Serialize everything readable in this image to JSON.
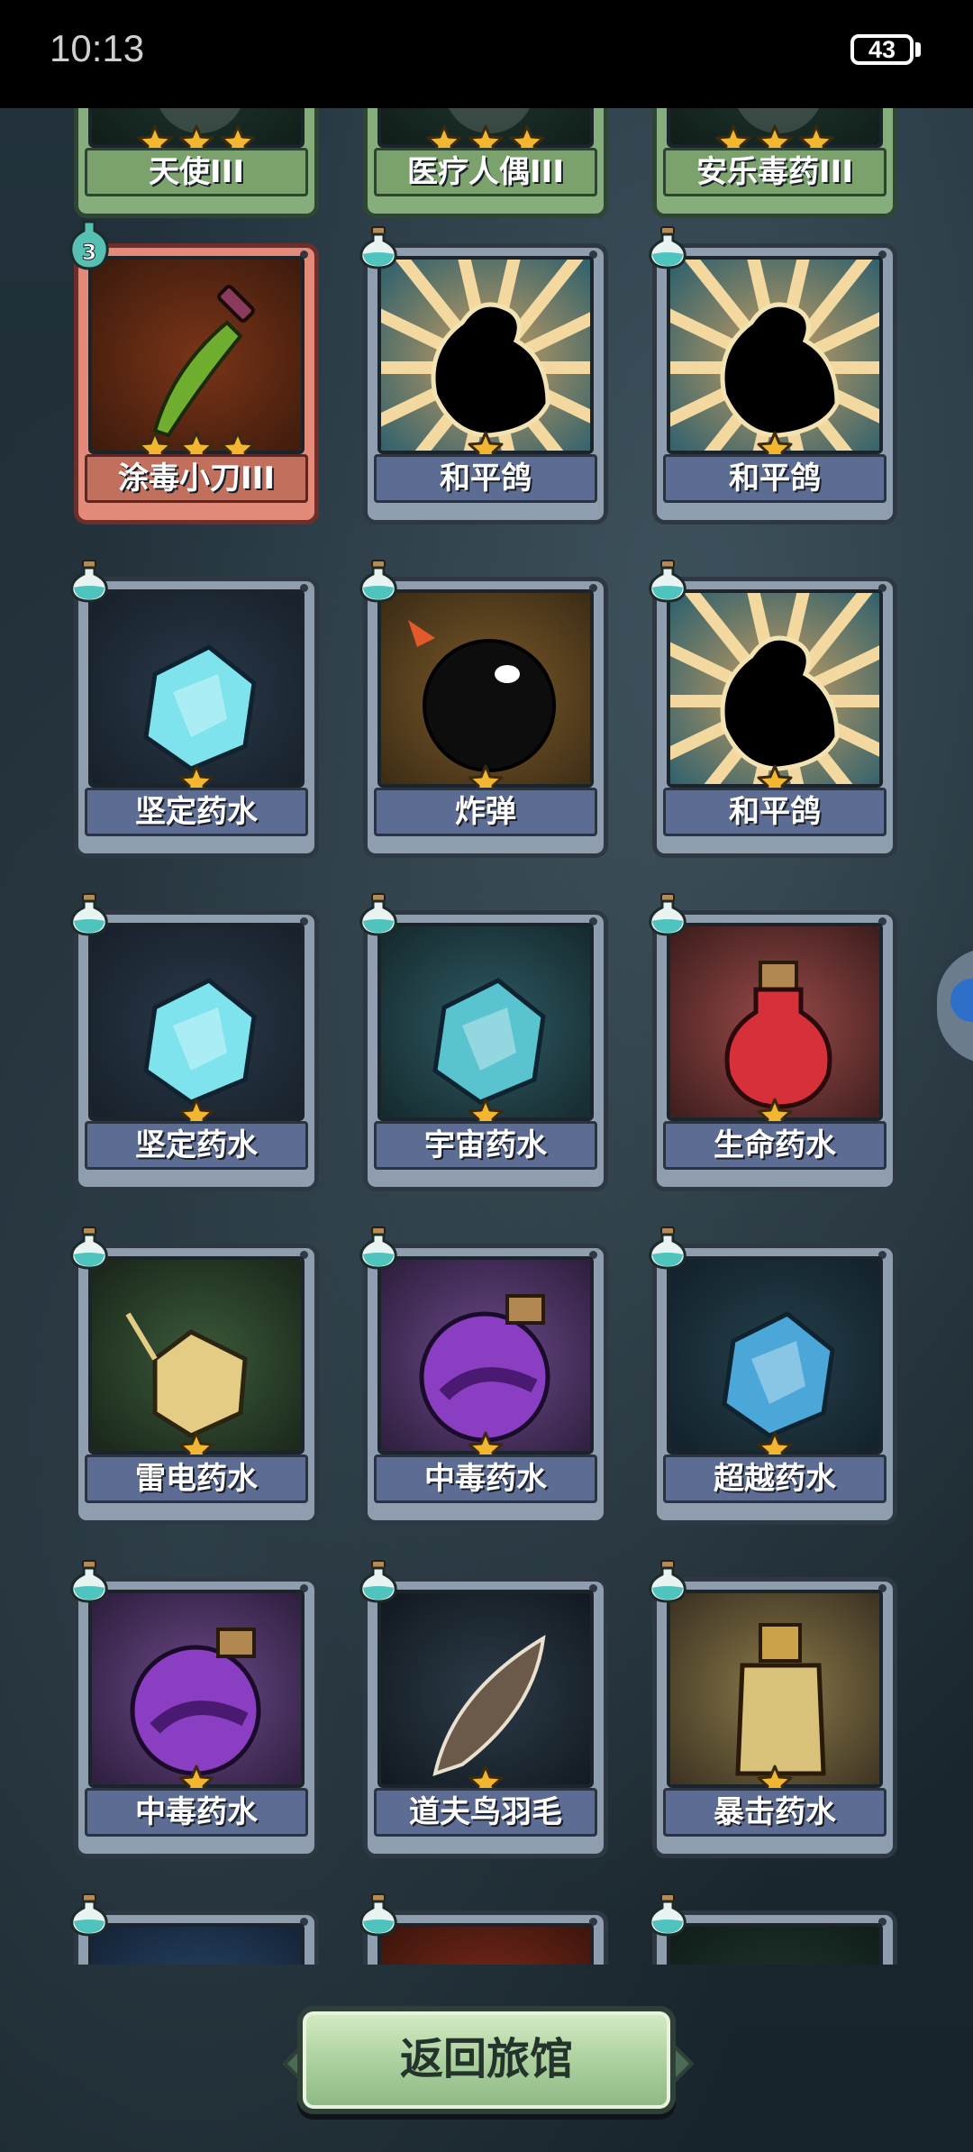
{
  "status_bar": {
    "time": "10:13",
    "battery": "43"
  },
  "cards": [
    {
      "name": "天使III",
      "stars": 3,
      "frame": "green",
      "partial_top": true
    },
    {
      "name": "医疗人偶III",
      "stars": 3,
      "frame": "green",
      "partial_top": true
    },
    {
      "name": "安乐毒药III",
      "stars": 3,
      "frame": "green",
      "partial_top": true
    },
    {
      "name": "涂毒小刀III",
      "stars": 3,
      "frame": "red",
      "level": "3",
      "art": "dagger"
    },
    {
      "name": "和平鸽",
      "stars": 1,
      "frame": "blue",
      "art": "dove"
    },
    {
      "name": "和平鸽",
      "stars": 1,
      "frame": "blue",
      "art": "dove"
    },
    {
      "name": "坚定药水",
      "stars": 1,
      "frame": "blue",
      "art": "crystal"
    },
    {
      "name": "炸弹",
      "stars": 1,
      "frame": "blue",
      "art": "bomb"
    },
    {
      "name": "和平鸽",
      "stars": 1,
      "frame": "blue",
      "art": "dove"
    },
    {
      "name": "坚定药水",
      "stars": 1,
      "frame": "blue",
      "art": "crystal"
    },
    {
      "name": "宇宙药水",
      "stars": 1,
      "frame": "blue",
      "art": "cosmic"
    },
    {
      "name": "生命药水",
      "stars": 1,
      "frame": "blue",
      "art": "life"
    },
    {
      "name": "雷电药水",
      "stars": 1,
      "frame": "blue",
      "art": "thunder"
    },
    {
      "name": "中毒药水",
      "stars": 1,
      "frame": "blue",
      "art": "poison"
    },
    {
      "name": "超越药水",
      "stars": 1,
      "frame": "blue",
      "art": "beyond"
    },
    {
      "name": "中毒药水",
      "stars": 1,
      "frame": "blue",
      "art": "poison"
    },
    {
      "name": "道夫鸟羽毛",
      "stars": 1,
      "frame": "blue",
      "art": "feather"
    },
    {
      "name": "暴击药水",
      "stars": 1,
      "frame": "blue",
      "art": "crit"
    },
    {
      "name": "",
      "stars": 0,
      "frame": "blue",
      "art": "partial-blue",
      "partial_bottom": true
    },
    {
      "name": "",
      "stars": 0,
      "frame": "blue",
      "art": "partial-red",
      "partial_bottom": true
    },
    {
      "name": "",
      "stars": 0,
      "frame": "blue",
      "art": "partial-dark",
      "partial_bottom": true
    }
  ],
  "buttons": {
    "return_label": "返回旅馆"
  },
  "colors": {
    "label_blue": "#5d6c92",
    "label_red": "#c0705c",
    "label_green": "#7ba16d",
    "star": "#f2b630",
    "button_green": "#a9cf9c"
  }
}
